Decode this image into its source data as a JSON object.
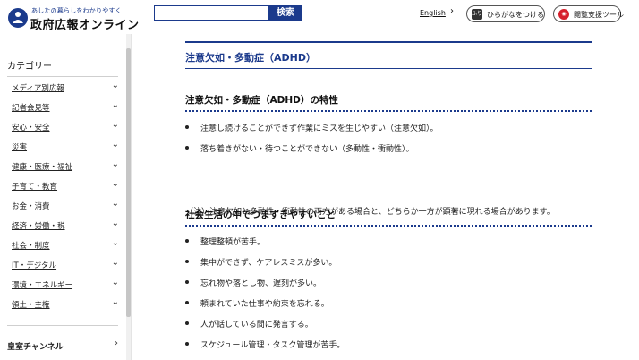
{
  "header": {
    "logo_tagline": "あしたの暮らしをわかりやすく",
    "logo_name": "政府広報オンライン",
    "search_placeholder": "",
    "search_button": "検索",
    "english_link": "English",
    "furigana_button": "ひらがなをつける",
    "furigana_icon_text": "ふり",
    "assist_button": "閲覧支援ツール"
  },
  "sidebar": {
    "heading": "カテゴリー",
    "items": [
      {
        "label": "メディア別広報"
      },
      {
        "label": "記者会見等"
      },
      {
        "label": "安心・安全"
      },
      {
        "label": "災害"
      },
      {
        "label": "健康・医療・福祉"
      },
      {
        "label": "子育て・教育"
      },
      {
        "label": "お金・消費"
      },
      {
        "label": "経済・労働・税"
      },
      {
        "label": "社会・制度"
      },
      {
        "label": "IT・デジタル"
      },
      {
        "label": "環境・エネルギー"
      },
      {
        "label": "領土・主権"
      }
    ],
    "bottom_item": "皇室チャンネル"
  },
  "main": {
    "title": "注意欠如・多動症（ADHD）",
    "section1": {
      "heading": "注意欠如・多動症（ADHD）の特性",
      "bullets": [
        "注意し続けることができず作業にミスを生じやすい（注意欠如）。",
        "落ち着きがない・待つことができない（多動性・衝動性）。"
      ],
      "note": "（注）注意欠如と多動性・衝動性の両方がある場合と、どちらか一方が顕著に現れる場合があります。"
    },
    "section2": {
      "heading": "社会生活の中でつまずきやすいこと",
      "bullets": [
        "整理整頓が苦手。",
        "集中ができず、ケアレスミスが多い。",
        "忘れ物や落とし物、遅刻が多い。",
        "頼まれていた仕事や約束を忘れる。",
        "人が話している間に発言する。",
        "スケジュール管理・タスク管理が苦手。"
      ]
    }
  },
  "colors": {
    "brand_navy": "#1b3a8c",
    "assist_red": "#d6202c"
  }
}
